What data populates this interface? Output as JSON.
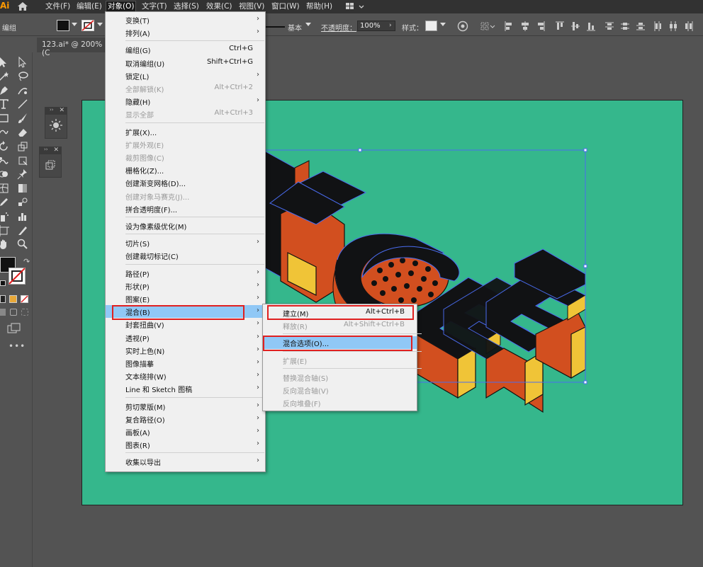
{
  "app": {
    "logo": "Ai"
  },
  "menubar": {
    "items": [
      "文件(F)",
      "编辑(E)",
      "对象(O)",
      "文字(T)",
      "选择(S)",
      "效果(C)",
      "视图(V)",
      "窗口(W)",
      "帮助(H)"
    ],
    "active_index": 2
  },
  "control_bar": {
    "selection_label": "编组",
    "stroke_style": "基本",
    "opacity_label": "不透明度：",
    "opacity_value": "100%",
    "style_label": "样式："
  },
  "document_tab": {
    "title": "123.ai* @ 200% (C"
  },
  "object_menu": {
    "items": [
      {
        "label": "变换(T)",
        "submenu": true
      },
      {
        "label": "排列(A)",
        "submenu": true
      },
      {
        "separator": true
      },
      {
        "label": "编组(G)",
        "shortcut": "Ctrl+G"
      },
      {
        "label": "取消编组(U)",
        "shortcut": "Shift+Ctrl+G"
      },
      {
        "label": "锁定(L)",
        "submenu": true
      },
      {
        "label": "全部解锁(K)",
        "shortcut": "Alt+Ctrl+2",
        "disabled": true
      },
      {
        "label": "隐藏(H)",
        "submenu": true
      },
      {
        "label": "显示全部",
        "shortcut": "Alt+Ctrl+3",
        "disabled": true
      },
      {
        "separator": true
      },
      {
        "label": "扩展(X)..."
      },
      {
        "label": "扩展外观(E)",
        "disabled": true
      },
      {
        "label": "裁剪图像(C)",
        "disabled": true
      },
      {
        "label": "栅格化(Z)..."
      },
      {
        "label": "创建渐变网格(D)..."
      },
      {
        "label": "创建对象马赛克(J)...",
        "disabled": true
      },
      {
        "label": "拼合透明度(F)..."
      },
      {
        "separator": true
      },
      {
        "label": "设为像素级优化(M)"
      },
      {
        "separator": true
      },
      {
        "label": "切片(S)",
        "submenu": true
      },
      {
        "label": "创建裁切标记(C)"
      },
      {
        "separator": true
      },
      {
        "label": "路径(P)",
        "submenu": true
      },
      {
        "label": "形状(P)",
        "submenu": true
      },
      {
        "label": "图案(E)",
        "submenu": true
      },
      {
        "label": "混合(B)",
        "submenu": true,
        "highlight": true
      },
      {
        "label": "封套扭曲(V)",
        "submenu": true
      },
      {
        "label": "透视(P)",
        "submenu": true
      },
      {
        "label": "实时上色(N)",
        "submenu": true
      },
      {
        "label": "图像描摹",
        "submenu": true
      },
      {
        "label": "文本绕排(W)",
        "submenu": true
      },
      {
        "label": "Line 和 Sketch 图稿",
        "submenu": true
      },
      {
        "separator": true
      },
      {
        "label": "剪切蒙版(M)",
        "submenu": true
      },
      {
        "label": "复合路径(O)",
        "submenu": true
      },
      {
        "label": "画板(A)",
        "submenu": true
      },
      {
        "label": "图表(R)",
        "submenu": true
      },
      {
        "separator": true
      },
      {
        "label": "收集以导出",
        "submenu": true
      }
    ]
  },
  "blend_submenu": {
    "items": [
      {
        "label": "建立(M)",
        "shortcut": "Alt+Ctrl+B"
      },
      {
        "label": "释放(R)",
        "shortcut": "Alt+Shift+Ctrl+B",
        "disabled": true
      },
      {
        "separator": true
      },
      {
        "label": "混合选项(O)...",
        "highlight": true
      },
      {
        "separator": true
      },
      {
        "label": "扩展(E)",
        "disabled": true
      },
      {
        "separator": true
      },
      {
        "label": "替换混合轴(S)",
        "disabled": true
      },
      {
        "label": "反向混合轴(V)",
        "disabled": true
      },
      {
        "label": "反向堆叠(F)",
        "disabled": true
      }
    ]
  },
  "colors": {
    "artboard": "#35b78c",
    "extrude_side": "#d24f1f",
    "extrude_end": "#f0c437",
    "letter_face": "#111214",
    "selection": "#4a6cf0",
    "menu_highlight": "#90c8f6",
    "annotation": "#e02020"
  },
  "tools": [
    "selection-tool-icon",
    "direct-selection-tool-icon",
    "magic-wand-icon",
    "lasso-icon",
    "pen-tool-icon",
    "curvature-icon",
    "type-tool-icon",
    "line-tool-icon",
    "rectangle-tool-icon",
    "paintbrush-icon",
    "shaper-icon",
    "eraser-icon",
    "rotate-icon",
    "scale-icon",
    "warp-icon",
    "free-transform-icon",
    "shape-builder-icon",
    "pin-icon",
    "mesh-icon",
    "gradient-icon",
    "eyedropper-icon",
    "blend-tool-icon",
    "symbol-sprayer-icon",
    "column-graph-icon",
    "artboard-tool-icon",
    "slice-icon",
    "hand-icon",
    "zoom-icon"
  ]
}
